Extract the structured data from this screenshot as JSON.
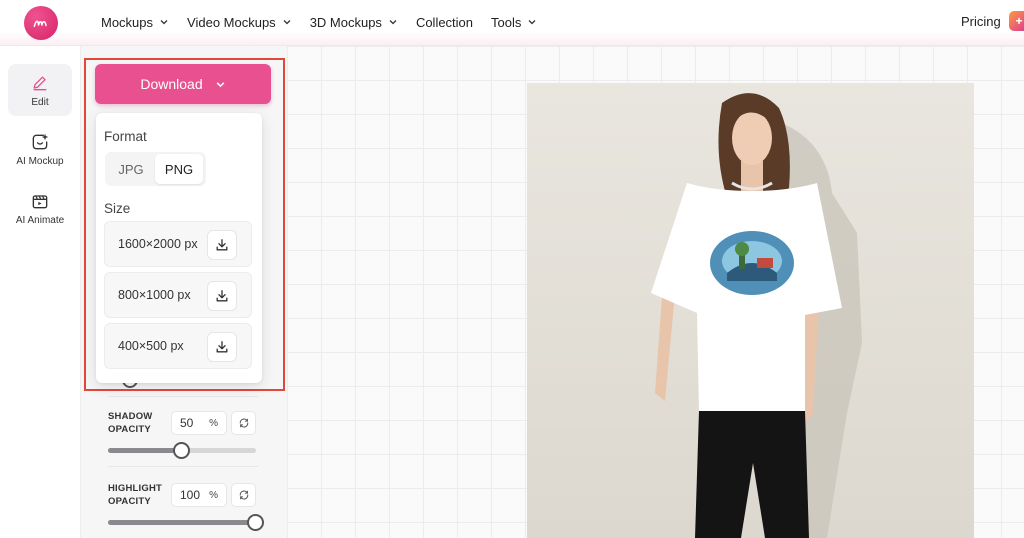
{
  "nav": {
    "items": [
      {
        "label": "Mockups",
        "dropdown": true
      },
      {
        "label": "Video Mockups",
        "dropdown": true
      },
      {
        "label": "3D Mockups",
        "dropdown": true
      },
      {
        "label": "Collection",
        "dropdown": false
      },
      {
        "label": "Tools",
        "dropdown": true
      }
    ],
    "pricing": "Pricing"
  },
  "rail": {
    "items": [
      {
        "label": "Edit",
        "icon": "pencil-icon",
        "active": true
      },
      {
        "label": "AI Mockup",
        "icon": "ai-mockup-icon",
        "active": false
      },
      {
        "label": "AI Animate",
        "icon": "clapperboard-icon",
        "active": false
      }
    ]
  },
  "download": {
    "button_label": "Download",
    "format_label": "Format",
    "formats": [
      "JPG",
      "PNG"
    ],
    "selected_format": "PNG",
    "size_label": "Size",
    "sizes": [
      "1600×2000 px",
      "800×1000 px",
      "400×500 px"
    ]
  },
  "settings": {
    "shadow": {
      "label_line1": "SHADOW",
      "label_line2": "OPACITY",
      "value": "50",
      "unit": "%",
      "level": 0.5
    },
    "highlight": {
      "label_line1": "HIGHLIGHT",
      "label_line2": "OPACITY",
      "value": "100",
      "unit": "%",
      "level": 1.0
    }
  },
  "colors": {
    "accent": "#e8508f",
    "highlight_frame": "#e0493a"
  }
}
